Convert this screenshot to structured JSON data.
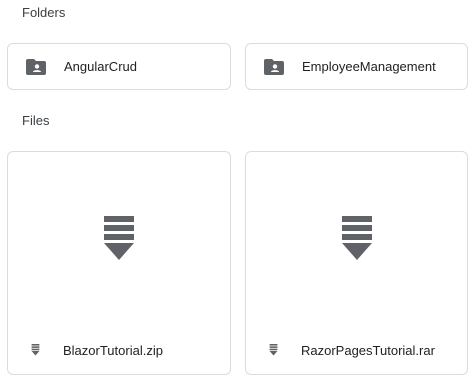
{
  "sections": {
    "folders_title": "Folders",
    "files_title": "Files"
  },
  "folders": [
    {
      "name": "AngularCrud",
      "icon": "shared-folder-icon"
    },
    {
      "name": "EmployeeManagement",
      "icon": "shared-folder-icon"
    }
  ],
  "files": [
    {
      "name": "BlazorTutorial.zip",
      "icon": "archive-icon"
    },
    {
      "name": "RazorPagesTutorial.rar",
      "icon": "archive-icon"
    }
  ],
  "colors": {
    "icon": "#5f6368",
    "border": "#dadce0",
    "text": "#202124"
  }
}
